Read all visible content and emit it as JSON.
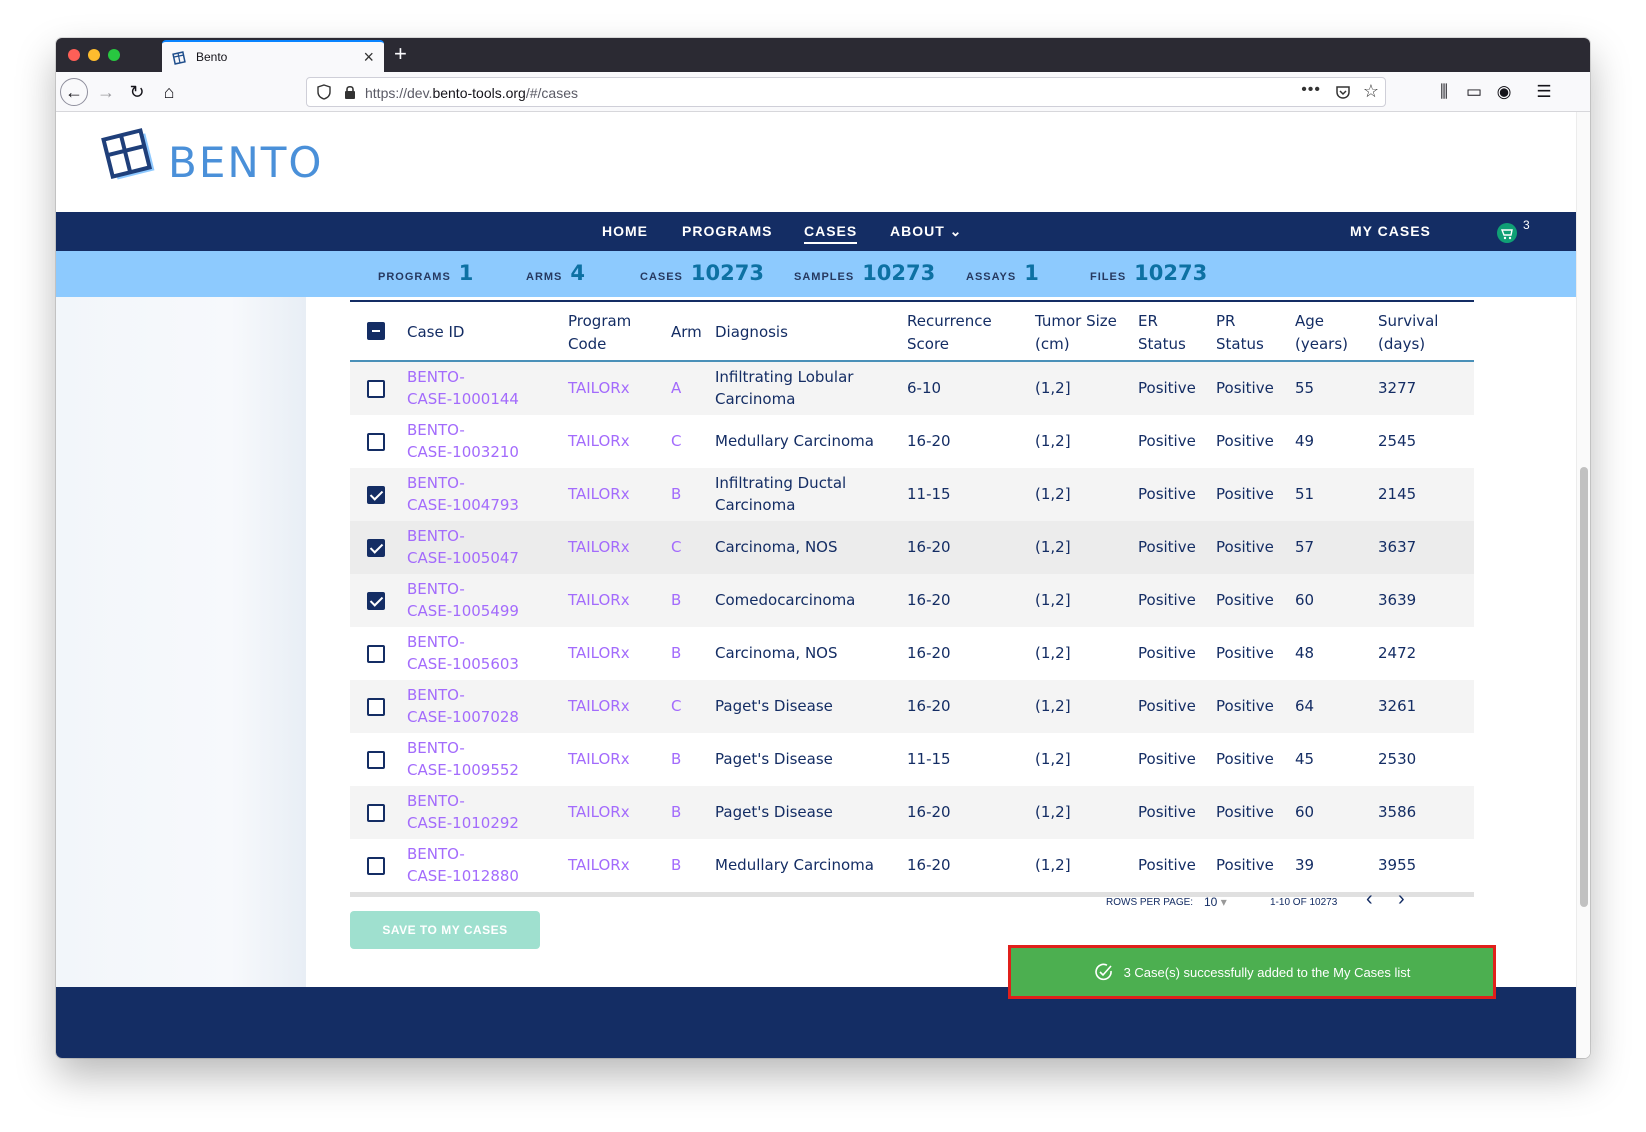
{
  "browser": {
    "tab_title": "Bento",
    "url_prefix": "https://dev.",
    "url_domain": "bento-tools.org",
    "url_suffix": "/#/cases"
  },
  "site": {
    "logo_text": "BENTO",
    "nav": {
      "home": "HOME",
      "programs": "PROGRAMS",
      "cases": "CASES",
      "about": "ABOUT",
      "about_caret": "⌄",
      "my_cases": "MY CASES",
      "cart_count": "3"
    },
    "stats": [
      {
        "label": "PROGRAMS",
        "value": "1"
      },
      {
        "label": "ARMS",
        "value": "4"
      },
      {
        "label": "CASES",
        "value": "10273"
      },
      {
        "label": "SAMPLES",
        "value": "10273"
      },
      {
        "label": "ASSAYS",
        "value": "1"
      },
      {
        "label": "FILES",
        "value": "10273"
      }
    ]
  },
  "table": {
    "headers": {
      "case_id": "Case ID",
      "program_code_1": "Program",
      "program_code_2": "Code",
      "arm": "Arm",
      "diagnosis": "Diagnosis",
      "recurrence_1": "Recurrence",
      "recurrence_2": "Score",
      "tumor_1": "Tumor Size",
      "tumor_2": "(cm)",
      "er_1": "ER",
      "er_2": "Status",
      "pr_1": "PR",
      "pr_2": "Status",
      "age_1": "Age",
      "age_2": "(years)",
      "survival_1": "Survival",
      "survival_2": "(days)"
    },
    "rows": [
      {
        "id1": "BENTO-",
        "id2": "CASE-1000144",
        "program": "TAILORx",
        "arm": "A",
        "dx1": "Infiltrating Lobular",
        "dx2": "Carcinoma",
        "recurrence": "6-10",
        "tumor": "(1,2]",
        "er": "Positive",
        "pr": "Positive",
        "age": "55",
        "survival": "3277",
        "checked": false
      },
      {
        "id1": "BENTO-",
        "id2": "CASE-1003210",
        "program": "TAILORx",
        "arm": "C",
        "dx1": "Medullary Carcinoma",
        "dx2": "",
        "recurrence": "16-20",
        "tumor": "(1,2]",
        "er": "Positive",
        "pr": "Positive",
        "age": "49",
        "survival": "2545",
        "checked": false
      },
      {
        "id1": "BENTO-",
        "id2": "CASE-1004793",
        "program": "TAILORx",
        "arm": "B",
        "dx1": "Infiltrating Ductal",
        "dx2": "Carcinoma",
        "recurrence": "11-15",
        "tumor": "(1,2]",
        "er": "Positive",
        "pr": "Positive",
        "age": "51",
        "survival": "2145",
        "checked": true
      },
      {
        "id1": "BENTO-",
        "id2": "CASE-1005047",
        "program": "TAILORx",
        "arm": "C",
        "dx1": "Carcinoma, NOS",
        "dx2": "",
        "recurrence": "16-20",
        "tumor": "(1,2]",
        "er": "Positive",
        "pr": "Positive",
        "age": "57",
        "survival": "3637",
        "checked": true
      },
      {
        "id1": "BENTO-",
        "id2": "CASE-1005499",
        "program": "TAILORx",
        "arm": "B",
        "dx1": "Comedocarcinoma",
        "dx2": "",
        "recurrence": "16-20",
        "tumor": "(1,2]",
        "er": "Positive",
        "pr": "Positive",
        "age": "60",
        "survival": "3639",
        "checked": true
      },
      {
        "id1": "BENTO-",
        "id2": "CASE-1005603",
        "program": "TAILORx",
        "arm": "B",
        "dx1": "Carcinoma, NOS",
        "dx2": "",
        "recurrence": "16-20",
        "tumor": "(1,2]",
        "er": "Positive",
        "pr": "Positive",
        "age": "48",
        "survival": "2472",
        "checked": false
      },
      {
        "id1": "BENTO-",
        "id2": "CASE-1007028",
        "program": "TAILORx",
        "arm": "C",
        "dx1": "Paget's Disease",
        "dx2": "",
        "recurrence": "16-20",
        "tumor": "(1,2]",
        "er": "Positive",
        "pr": "Positive",
        "age": "64",
        "survival": "3261",
        "checked": false
      },
      {
        "id1": "BENTO-",
        "id2": "CASE-1009552",
        "program": "TAILORx",
        "arm": "B",
        "dx1": "Paget's Disease",
        "dx2": "",
        "recurrence": "11-15",
        "tumor": "(1,2]",
        "er": "Positive",
        "pr": "Positive",
        "age": "45",
        "survival": "2530",
        "checked": false
      },
      {
        "id1": "BENTO-",
        "id2": "CASE-1010292",
        "program": "TAILORx",
        "arm": "B",
        "dx1": "Paget's Disease",
        "dx2": "",
        "recurrence": "16-20",
        "tumor": "(1,2]",
        "er": "Positive",
        "pr": "Positive",
        "age": "60",
        "survival": "3586",
        "checked": false
      },
      {
        "id1": "BENTO-",
        "id2": "CASE-1012880",
        "program": "TAILORx",
        "arm": "B",
        "dx1": "Medullary Carcinoma",
        "dx2": "",
        "recurrence": "16-20",
        "tumor": "(1,2]",
        "er": "Positive",
        "pr": "Positive",
        "age": "39",
        "survival": "3955",
        "checked": false
      }
    ],
    "pagination": {
      "rows_per_page_label": "ROWS PER PAGE:",
      "rows_per_page_value": "10",
      "range": "1-10 OF 10273",
      "prev": "‹",
      "next": "›"
    }
  },
  "save_button": "SAVE TO MY CASES",
  "toast": {
    "message": "3 Case(s) successfully added to the My Cases list",
    "color": "#4caf50"
  },
  "colors": {
    "nav_bg": "#142d64",
    "stats_bg": "#8dcafe",
    "link": "#a36bfc"
  }
}
